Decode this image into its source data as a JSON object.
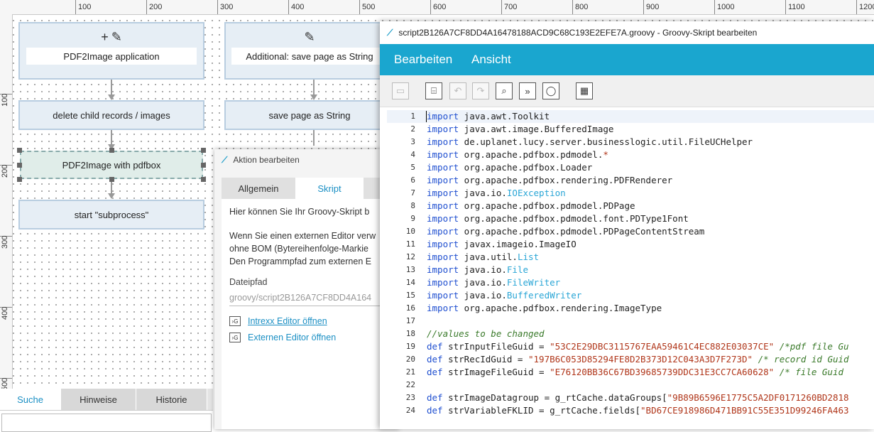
{
  "ruler": {
    "top_labels": [
      "100",
      "200",
      "300",
      "400",
      "500",
      "600",
      "700",
      "800",
      "900",
      "1000",
      "1100",
      "1200"
    ],
    "left_labels": [
      "100",
      "200",
      "300",
      "400",
      "500"
    ]
  },
  "process": {
    "nodes": [
      {
        "label": "PDF2Image application"
      },
      {
        "label": "delete child records / images"
      },
      {
        "label": "PDF2Image with pdfbox"
      },
      {
        "label": "start \"subprocess\""
      },
      {
        "label": "Additional: save page as String"
      },
      {
        "label": "save page as String"
      }
    ],
    "icons": [
      "plus-icon",
      "pencil-icon"
    ]
  },
  "bottom_tabs": [
    {
      "label": "Suche"
    },
    {
      "label": "Hinweise"
    },
    {
      "label": "Historie"
    }
  ],
  "aktion_dialog": {
    "title": "Aktion bearbeiten",
    "tabs": [
      {
        "label": "Allgemein"
      },
      {
        "label": "Skript"
      }
    ],
    "intro": "Hier können Sie Ihr Groovy-Skript b",
    "text_lines": [
      "Wenn Sie einen externen Editor verw",
      "ohne BOM (Bytereihenfolge-Markie",
      "Den Programmpfad zum externen E"
    ],
    "path_label": "Dateipfad",
    "path_value": "groovy/script2B126A7CF8DD4A164",
    "links": [
      {
        "label": "Intrexx Editor öffnen"
      },
      {
        "label": "Externen Editor öffnen"
      }
    ]
  },
  "editor": {
    "title": "script2B126A7CF8DD4A16478188ACD9C68C193E2EFE7A.groovy - Groovy-Skript bearbeiten",
    "menu": [
      {
        "label": "Bearbeiten"
      },
      {
        "label": "Ansicht"
      }
    ],
    "toolbar": [
      "save-icon",
      "editor-icon",
      "undo-icon",
      "redo-icon",
      "search-icon",
      "jump-icon",
      "comment-icon",
      "calendar-icon"
    ],
    "code_lines": [
      [
        {
          "t": "kw",
          "v": "import"
        },
        {
          "t": "",
          "v": " java.awt.Toolkit"
        }
      ],
      [
        {
          "t": "kw",
          "v": "import"
        },
        {
          "t": "",
          "v": " java.awt.image.BufferedImage"
        }
      ],
      [
        {
          "t": "kw",
          "v": "import"
        },
        {
          "t": "",
          "v": " de.uplanet.lucy.server.businesslogic.util.FileUCHelper"
        }
      ],
      [
        {
          "t": "kw",
          "v": "import"
        },
        {
          "t": "",
          "v": " org.apache.pdfbox.pdmodel."
        },
        {
          "t": "str",
          "v": "*"
        }
      ],
      [
        {
          "t": "kw",
          "v": "import"
        },
        {
          "t": "",
          "v": " org.apache.pdfbox.Loader"
        }
      ],
      [
        {
          "t": "kw",
          "v": "import"
        },
        {
          "t": "",
          "v": " org.apache.pdfbox.rendering.PDFRenderer"
        }
      ],
      [
        {
          "t": "kw",
          "v": "import"
        },
        {
          "t": "",
          "v": " java.io."
        },
        {
          "t": "cls",
          "v": "IOException"
        }
      ],
      [
        {
          "t": "kw",
          "v": "import"
        },
        {
          "t": "",
          "v": " org.apache.pdfbox.pdmodel.PDPage"
        }
      ],
      [
        {
          "t": "kw",
          "v": "import"
        },
        {
          "t": "",
          "v": " org.apache.pdfbox.pdmodel.font.PDType1Font"
        }
      ],
      [
        {
          "t": "kw",
          "v": "import"
        },
        {
          "t": "",
          "v": " org.apache.pdfbox.pdmodel.PDPageContentStream"
        }
      ],
      [
        {
          "t": "kw",
          "v": "import"
        },
        {
          "t": "",
          "v": " javax.imageio.ImageIO"
        }
      ],
      [
        {
          "t": "kw",
          "v": "import"
        },
        {
          "t": "",
          "v": " java.util."
        },
        {
          "t": "cls",
          "v": "List"
        }
      ],
      [
        {
          "t": "kw",
          "v": "import"
        },
        {
          "t": "",
          "v": " java.io."
        },
        {
          "t": "cls",
          "v": "File"
        }
      ],
      [
        {
          "t": "kw",
          "v": "import"
        },
        {
          "t": "",
          "v": " java.io."
        },
        {
          "t": "cls",
          "v": "FileWriter"
        }
      ],
      [
        {
          "t": "kw",
          "v": "import"
        },
        {
          "t": "",
          "v": " java.io."
        },
        {
          "t": "cls",
          "v": "BufferedWriter"
        }
      ],
      [
        {
          "t": "kw",
          "v": "import"
        },
        {
          "t": "",
          "v": " org.apache.pdfbox.rendering.ImageType"
        }
      ],
      [],
      [
        {
          "t": "cm",
          "v": "//values to be changed"
        }
      ],
      [
        {
          "t": "kw",
          "v": "def"
        },
        {
          "t": "",
          "v": " strInputFileGuid = "
        },
        {
          "t": "str",
          "v": "\"53C2E29DBC3115767EAA59461C4EC882E03037CE\""
        },
        {
          "t": "",
          "v": " "
        },
        {
          "t": "cm",
          "v": "/*pdf file Gu"
        }
      ],
      [
        {
          "t": "kw",
          "v": "def"
        },
        {
          "t": "",
          "v": " strRecIdGuid = "
        },
        {
          "t": "str",
          "v": "\"197B6C053D85294FE8D2B373D12C043A3D7F273D\""
        },
        {
          "t": "",
          "v": " "
        },
        {
          "t": "cm",
          "v": "/* record id Guid"
        }
      ],
      [
        {
          "t": "kw",
          "v": "def"
        },
        {
          "t": "",
          "v": " strImageFileGuid = "
        },
        {
          "t": "str",
          "v": "\"E76120BB36C67BD39685739DDC31E3CC7CA60628\""
        },
        {
          "t": "",
          "v": " "
        },
        {
          "t": "cm",
          "v": "/* file Guid"
        }
      ],
      [],
      [
        {
          "t": "kw",
          "v": "def"
        },
        {
          "t": "",
          "v": " strImageDatagroup = g_rtCache.dataGroups["
        },
        {
          "t": "str",
          "v": "\"9B89B6596E1775C5A2DF0171260BD2818"
        }
      ],
      [
        {
          "t": "kw",
          "v": "def"
        },
        {
          "t": "",
          "v": " strVariableFKLID = g_rtCache.fields["
        },
        {
          "t": "str",
          "v": "\"BD67CE918986D471BB91C55E351D99246FA463"
        }
      ]
    ]
  }
}
